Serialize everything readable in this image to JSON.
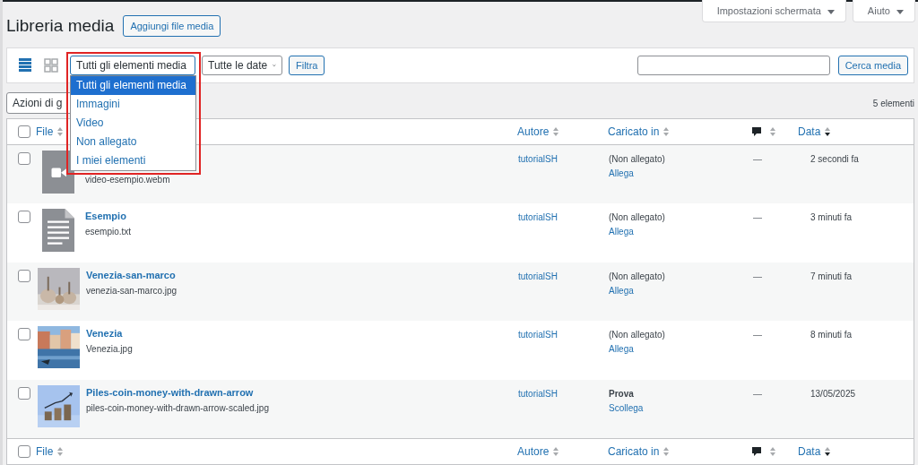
{
  "header": {
    "title": "Libreria media",
    "add_button": "Aggiungi file media",
    "screen_tabs": [
      {
        "label": "Impostazioni schermata",
        "expanded": false
      },
      {
        "label": "Aiuto",
        "expanded": false
      }
    ]
  },
  "filter_bar": {
    "view_modes": [
      {
        "kind": "list",
        "selected": true
      },
      {
        "kind": "grid",
        "selected": false
      }
    ],
    "type_select": {
      "value": "Tutti gli elementi media",
      "expanded": true,
      "options": [
        {
          "label": "Tutti gli elementi media",
          "selected": true
        },
        {
          "label": "Immagini",
          "selected": false
        },
        {
          "label": "Video",
          "selected": false
        },
        {
          "label": "Non allegato",
          "selected": false
        },
        {
          "label": "I miei elementi",
          "selected": false
        }
      ]
    },
    "date_select": {
      "value": "Tutte le date"
    },
    "filter_button": "Filtra",
    "search_button": "Cerca media",
    "highlighted": true
  },
  "bulk_actions": {
    "value": "Azioni di g",
    "count": "5 elementi"
  },
  "table": {
    "columns": [
      {
        "kind": "text",
        "label": "File",
        "sorted": false
      },
      {
        "kind": "text",
        "label": "Autore",
        "sorted": false
      },
      {
        "kind": "text",
        "label": "Caricato in",
        "sorted": false
      },
      {
        "kind": "comments",
        "sorted": false
      },
      {
        "kind": "text",
        "label": "Data",
        "sorted": true
      }
    ],
    "footer_columns": [
      {
        "kind": "text",
        "label": "File",
        "sorted": false
      },
      {
        "kind": "text",
        "label": "Autore",
        "sorted": false
      },
      {
        "kind": "text",
        "label": "Caricato in",
        "sorted": false
      },
      {
        "kind": "comments",
        "sorted": false
      },
      {
        "kind": "text",
        "label": "Data",
        "sorted": true
      }
    ],
    "header_checked": false,
    "footer_checked": false,
    "rows": [
      {
        "checked": false,
        "kind": "video",
        "filename": "video-esempio.webm",
        "author": "tutorialSH",
        "attached": "(Non allegato)",
        "attached_bold": false,
        "action": "Allega",
        "comments": "—",
        "date": "2 secondi fa"
      },
      {
        "checked": false,
        "kind": "document",
        "title": "Esempio",
        "filename": "esempio.txt",
        "author": "tutorialSH",
        "attached": "(Non allegato)",
        "attached_bold": false,
        "action": "Allega",
        "comments": "—",
        "date": "3 minuti fa"
      },
      {
        "checked": false,
        "kind": "picture",
        "title": "Venezia-san-marco",
        "filename": "venezia-san-marco.jpg",
        "author": "tutorialSH",
        "attached": "(Non allegato)",
        "attached_bold": false,
        "action": "Allega",
        "comments": "—",
        "date": "7 minuti fa"
      },
      {
        "checked": false,
        "kind": "picture",
        "title": "Venezia",
        "filename": "Venezia.jpg",
        "author": "tutorialSH",
        "attached": "(Non allegato)",
        "attached_bold": false,
        "action": "Allega",
        "comments": "—",
        "date": "8 minuti fa"
      },
      {
        "checked": false,
        "kind": "picture",
        "title": "Piles-coin-money-with-drawn-arrow",
        "filename": "piles-coin-money-with-drawn-arrow-scaled.jpg",
        "author": "tutorialSH",
        "attached": "Prova",
        "attached_bold": true,
        "action": "Scollega",
        "comments": "—",
        "date": "13/05/2025"
      }
    ]
  }
}
